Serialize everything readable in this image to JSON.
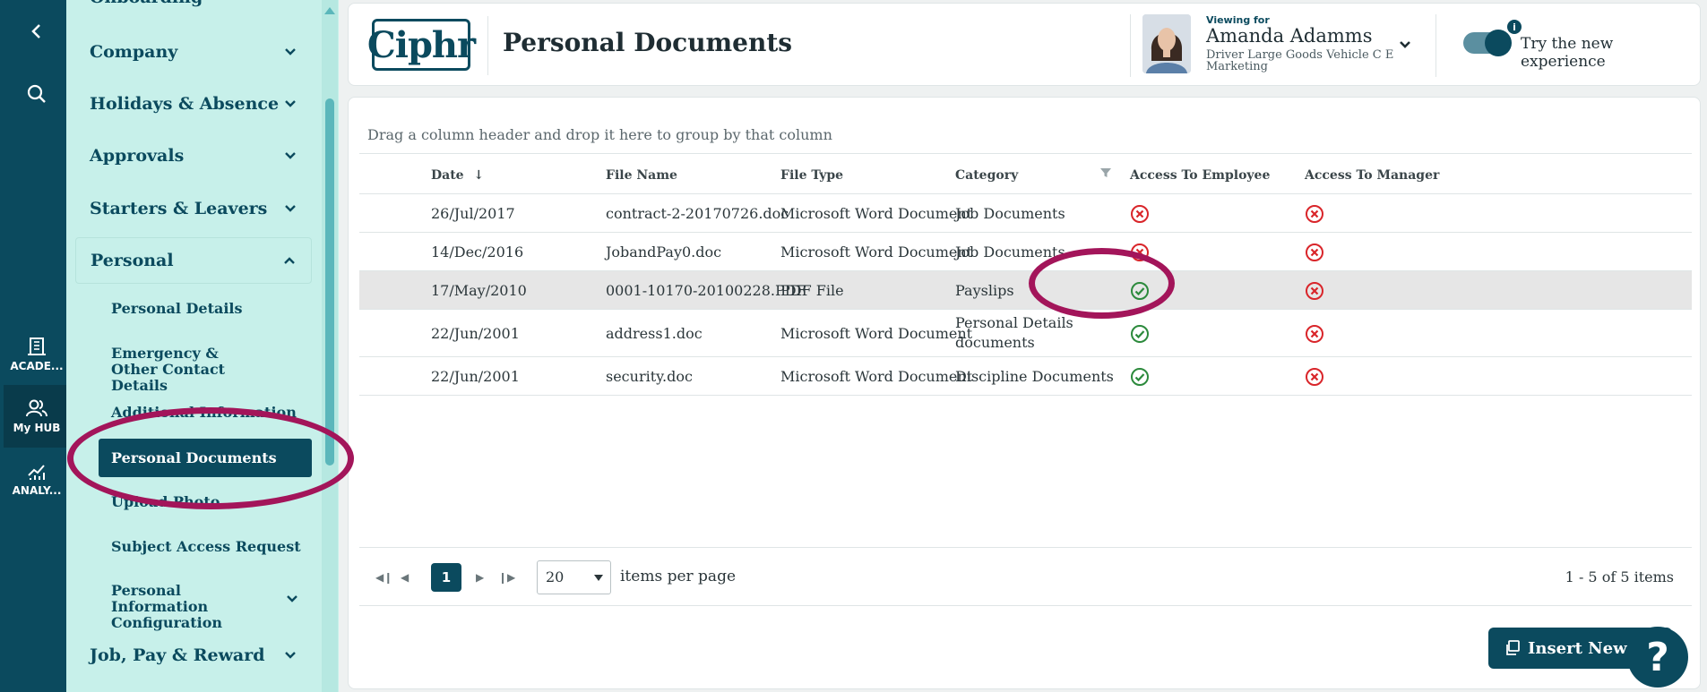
{
  "rail": {
    "items": [
      {
        "name": "back",
        "label": ""
      },
      {
        "name": "search",
        "label": ""
      },
      {
        "name": "academy",
        "label": "ACADE..."
      },
      {
        "name": "my-hub",
        "label": "My HUB"
      },
      {
        "name": "analytics",
        "label": "ANALY..."
      }
    ]
  },
  "sidebar": {
    "top_cut": "Onboarding",
    "sections": [
      {
        "label": "Company"
      },
      {
        "label": "Holidays & Absence"
      },
      {
        "label": "Approvals"
      },
      {
        "label": "Starters & Leavers"
      },
      {
        "label": "Personal"
      }
    ],
    "personal_items": [
      {
        "label": "Personal Details"
      },
      {
        "label": "Emergency & Other Contact Details"
      },
      {
        "label": "Additional Information"
      },
      {
        "label": "Personal Documents"
      },
      {
        "label": "Upload Photo"
      },
      {
        "label": "Subject Access Request"
      },
      {
        "label": "Personal Information Configuration"
      }
    ],
    "bottom_section": "Job, Pay & Reward"
  },
  "header": {
    "logo": "Ciphr",
    "title": "Personal Documents",
    "viewing_label": "Viewing for",
    "viewing_name": "Amanda Adamms",
    "viewing_role": "Driver Large Goods Vehicle C E",
    "viewing_dept": "Marketing",
    "toggle_label": "Try the new experience",
    "toggle_on": true
  },
  "grid": {
    "group_hint": "Drag a column header and drop it here to group by that column",
    "columns": [
      "Date",
      "File Name",
      "File Type",
      "Category",
      "Access To Employee",
      "Access To Manager"
    ],
    "rows": [
      {
        "date": "26/Jul/2017",
        "file": "contract-2-20170726.doc",
        "type": "Microsoft Word Document",
        "category": "Job Documents",
        "emp": false,
        "mgr": false
      },
      {
        "date": "14/Dec/2016",
        "file": "JobandPay0.doc",
        "type": "Microsoft Word Document",
        "category": "Job Documents",
        "emp": false,
        "mgr": false
      },
      {
        "date": "17/May/2010",
        "file": "0001-10170-20100228.PDF",
        "type": "PDF File",
        "category": "Payslips",
        "emp": true,
        "mgr": false
      },
      {
        "date": "22/Jun/2001",
        "file": "address1.doc",
        "type": "Microsoft Word Document",
        "category": "Personal Details documents",
        "emp": true,
        "mgr": false
      },
      {
        "date": "22/Jun/2001",
        "file": "security.doc",
        "type": "Microsoft Word Document",
        "category": "Discipline Documents",
        "emp": true,
        "mgr": false
      }
    ]
  },
  "pager": {
    "current": "1",
    "page_size": "20",
    "items_per_page": "items per page",
    "info": "1 - 5 of 5 items"
  },
  "actions": {
    "insert_label": "Insert New R",
    "help_label": "?"
  },
  "colors": {
    "brand": "#0b4a5e",
    "sidebar": "#c7f0ea",
    "annotation": "#a3155a",
    "error": "#d9252a",
    "success": "#2c8a3c"
  }
}
